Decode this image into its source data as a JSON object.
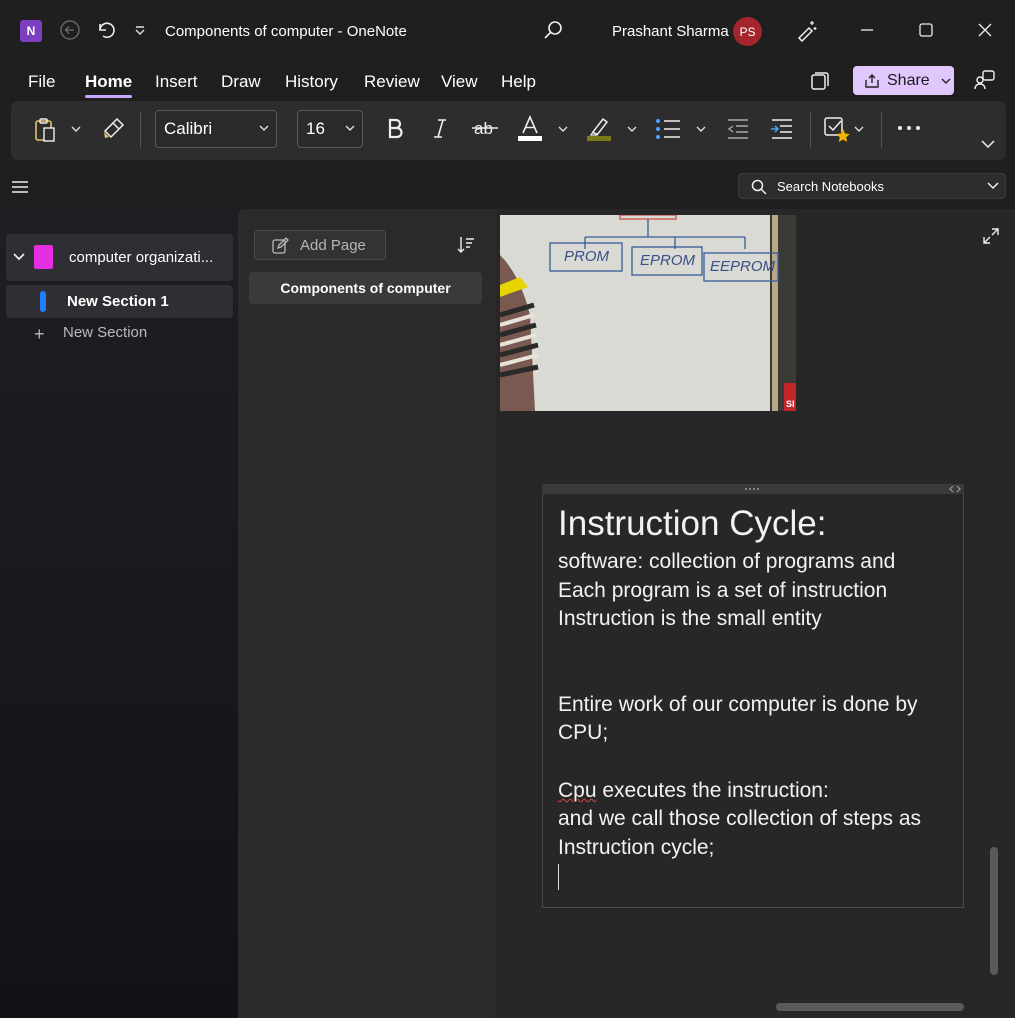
{
  "titlebar": {
    "window_title": "Components of computer  -  OneNote",
    "user_name": "Prashant Sharma",
    "avatar_initials": "PS",
    "app_icon_letter": "N"
  },
  "menu": {
    "items": [
      "File",
      "Home",
      "Insert",
      "Draw",
      "History",
      "Review",
      "View",
      "Help"
    ],
    "active": "Home",
    "share_label": "Share"
  },
  "ribbon": {
    "font_name": "Calibri",
    "font_size": "16"
  },
  "search": {
    "placeholder": "Search Notebooks"
  },
  "nav": {
    "notebook_name": "computer organizati...",
    "section_name": "New Section 1",
    "new_section_label": "New Section"
  },
  "pages": {
    "add_page_label": "Add Page",
    "items": [
      "Components of computer"
    ]
  },
  "whiteboard": {
    "labels": [
      "PROM",
      "EPROM",
      "EEPROM"
    ],
    "edge_text": "SI"
  },
  "note": {
    "heading": "Instruction Cycle:",
    "lines": [
      "software: collection of programs and",
      "Each program is a set of instruction",
      "Instruction is the small entity",
      "Entire work of our computer is done by",
      "CPU;",
      "Cpu",
      " executes the instruction:",
      "and we call those collection of steps as",
      "Instruction cycle;"
    ]
  },
  "colors": {
    "accent": "#c8a8ff",
    "share_bg": "#e0c8ff",
    "notebook": "#e52ee0",
    "section_tab": "#1f7dff",
    "avatar": "#a4262c"
  }
}
